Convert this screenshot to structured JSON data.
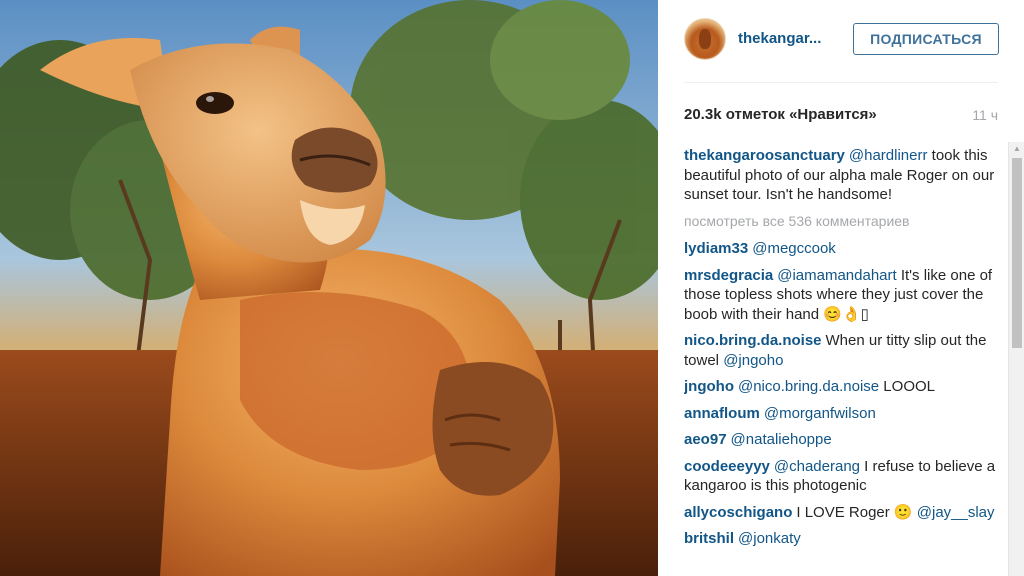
{
  "post": {
    "username": "thekangar...",
    "follow_label": "ПОДПИСАТЬСЯ",
    "likes": "20.3k отметок «Нравится»",
    "time_ago": "11 ч",
    "view_all_comments": "посмотреть все 536 комментариев"
  },
  "caption": {
    "user": "thekangaroosanctuary",
    "mention": "@hardlinerr",
    "text": " took this beautiful photo of our alpha male Roger on our sunset tour. Isn't he handsome!"
  },
  "comments": [
    {
      "user": "lydiam33",
      "mention": "@megccook",
      "text": ""
    },
    {
      "user": "mrsdegracia",
      "mention": "@iamamandahart",
      "text": " It's like one of those topless shots where they just cover the boob with their hand 😊👌▯"
    },
    {
      "user": "nico.bring.da.noise",
      "mention": "",
      "text": "When ur titty slip out the towel ",
      "mention2": "@jngoho"
    },
    {
      "user": "jngoho",
      "mention": "@nico.bring.da.noise",
      "text": " LOOOL"
    },
    {
      "user": "annafloum",
      "mention": "@morganfwilson",
      "text": ""
    },
    {
      "user": "aeo97",
      "mention": "@nataliehoppe",
      "text": ""
    },
    {
      "user": "coodeeeyyy",
      "mention": "@chaderang",
      "text": " I refuse to believe a kangaroo is this photogenic"
    },
    {
      "user": "allycoschigano",
      "mention": "",
      "text": "I LOVE Roger 🙂 ",
      "mention2": "@jay__slay"
    },
    {
      "user": "britshil",
      "mention": "@jonkaty",
      "text": ""
    }
  ],
  "colors": {
    "link": "#125688",
    "follow_border": "#3f729b",
    "muted": "#a5a7aa"
  }
}
